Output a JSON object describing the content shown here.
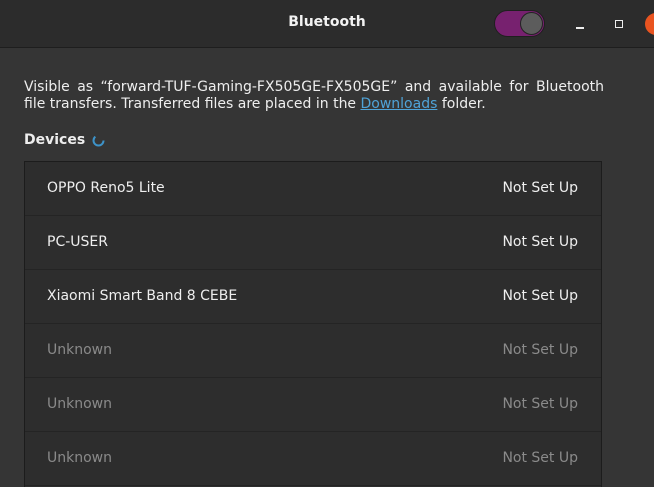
{
  "window": {
    "title": "Bluetooth",
    "bluetooth_enabled": true,
    "accent_color": "#77216f",
    "close_button_color": "#e95420"
  },
  "info": {
    "text_before_link": "Visible as “forward-TUF-Gaming-FX505GE-FX505GE” and available for Bluetooth file transfers. Transferred files are placed in the ",
    "link_text": "Downloads",
    "text_after_link": " folder."
  },
  "devices": {
    "header": "Devices",
    "items": [
      {
        "name": "OPPO Reno5 Lite",
        "status": "Not Set Up",
        "dimmed": false
      },
      {
        "name": "PC-USER",
        "status": "Not Set Up",
        "dimmed": false
      },
      {
        "name": "Xiaomi Smart Band 8 CEBE",
        "status": "Not Set Up",
        "dimmed": false
      },
      {
        "name": "Unknown",
        "status": "Not Set Up",
        "dimmed": true
      },
      {
        "name": "Unknown",
        "status": "Not Set Up",
        "dimmed": true
      },
      {
        "name": "Unknown",
        "status": "Not Set Up",
        "dimmed": true
      }
    ]
  },
  "icons": {
    "spinner": "loading-spinner-icon",
    "minimize": "minimize-icon",
    "maximize": "maximize-icon",
    "close": "close-icon"
  }
}
